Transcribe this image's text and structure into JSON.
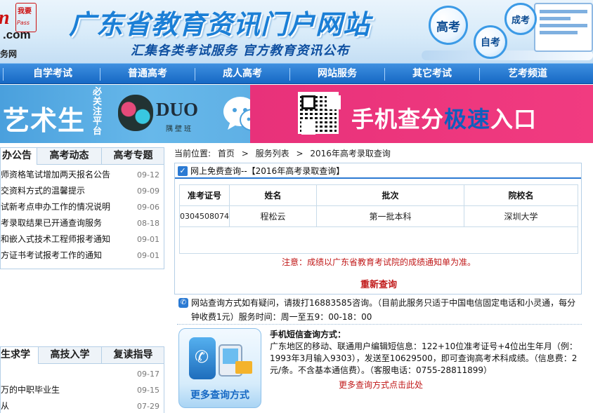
{
  "header": {
    "logo_badge_top": "我要",
    "logo_badge_bottom": "Pass",
    "logo_letter": "n",
    "logo_domain": ".com",
    "logo_sub": "务网",
    "site_title": "广东省教育资讯门户网站",
    "slogan": "汇集各类考试服务  官方教育资讯公布",
    "bubbles": [
      "高考",
      "自考",
      "成考"
    ]
  },
  "nav": {
    "items": [
      "自学考试",
      "普通高考",
      "成人高考",
      "网站服务",
      "其它考试",
      "艺考频道"
    ]
  },
  "banner": {
    "art_text": "艺术生",
    "must_text": "必关注平台",
    "duo_text": "DUO",
    "duo_sub": "隅壁班",
    "phone_text": "手机查分",
    "fast_text": "极速",
    "entry_text": "入口"
  },
  "left_top": {
    "tabs": [
      "办公告",
      "高考动态",
      "高考专题"
    ],
    "news": [
      {
        "title": "师资格笔试增加两天报名公告",
        "date": "09-12"
      },
      {
        "title": "交资料方式的温馨提示",
        "date": "09-09"
      },
      {
        "title": "试新考点申办工作的情况说明",
        "date": "09-06"
      },
      {
        "title": "考录取结果已开通查询服务",
        "date": "08-18"
      },
      {
        "title": "和嵌入式技术工程师报考通知",
        "date": "09-01"
      },
      {
        "title": "方证书考试报考工作的通知",
        "date": "09-01"
      }
    ]
  },
  "left_bottom": {
    "tabs": [
      "生求学",
      "高技入学",
      "复读指导"
    ],
    "news": [
      {
        "title": "",
        "date": "09-17"
      },
      {
        "title": "万的中职毕业生",
        "date": "09-15"
      },
      {
        "title": "从",
        "date": "07-29"
      }
    ]
  },
  "breadcrumb": {
    "label": "当前位置:",
    "items": [
      "首页",
      ">",
      "服务列表",
      ">",
      "2016年高考录取查询"
    ]
  },
  "result": {
    "header": "网上免费查询--【2016年高考录取查询】",
    "columns": [
      "准考证号",
      "姓名",
      "批次",
      "院校名"
    ],
    "row": [
      "0304508074",
      "程松云",
      "第一批本科",
      "深圳大学"
    ],
    "notice": "注意：成绩以广东省教育考试院的成绩通知单为准。",
    "requery": "重新查询"
  },
  "phone_note": "网站查询方式如有疑问，请拨打16883585咨询。（目前此服务只适于中国电信固定电话和小灵通，每分钟收费1元）服务时间：周一至五9：00-18：00",
  "sms": {
    "image_label": "更多查询方式",
    "title": "手机短信查询方式：",
    "body": "广东地区的移动、联通用户编辑短信息：122+10位准考证号+4位出生年月（例：1993年3月输入9303），发送至10629500，即可查询高考术科成绩。（信息费：2元/条。不含基本通信费）。（客服电话：0755-28811899）",
    "more": "更多查询方式点击此处"
  },
  "colors": {
    "nav_blue": "#1668c4",
    "title_blue": "#1b7fd6",
    "banner_pink": "#e8317a",
    "notice_red": "#c01818"
  }
}
